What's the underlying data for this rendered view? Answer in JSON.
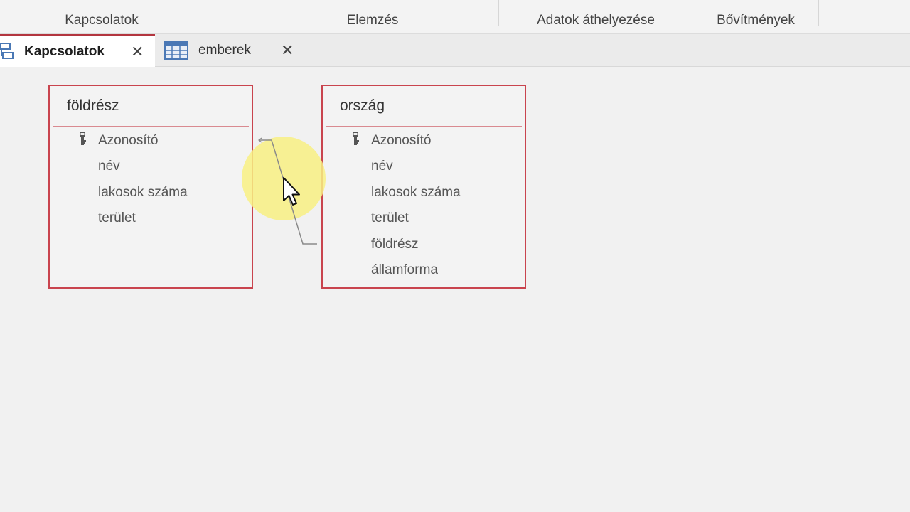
{
  "ribbon": {
    "groups": [
      "Kapcsolatok",
      "Elemzés",
      "Adatok áthelyezése",
      "Bővítmények"
    ]
  },
  "tabs": [
    {
      "label": "Kapcsolatok",
      "icon": "relationships-icon",
      "active": true
    },
    {
      "label": "emberek",
      "icon": "table-icon",
      "active": false
    }
  ],
  "close_glyph": "✕",
  "tables": [
    {
      "name": "földrész",
      "fields": [
        "Azonosító",
        "név",
        "lakosok száma",
        "terület"
      ],
      "primary_key": "Azonosító"
    },
    {
      "name": "ország",
      "fields": [
        "Azonosító",
        "név",
        "lakosok száma",
        "terület",
        "földrész",
        "államforma"
      ],
      "primary_key": "Azonosító"
    }
  ],
  "relationship": {
    "from": "földrész.Azonosító",
    "to": "ország.földrész"
  },
  "colors": {
    "accent": "#b3363f",
    "table_border": "#c9444e",
    "highlight": "#f8f082"
  }
}
